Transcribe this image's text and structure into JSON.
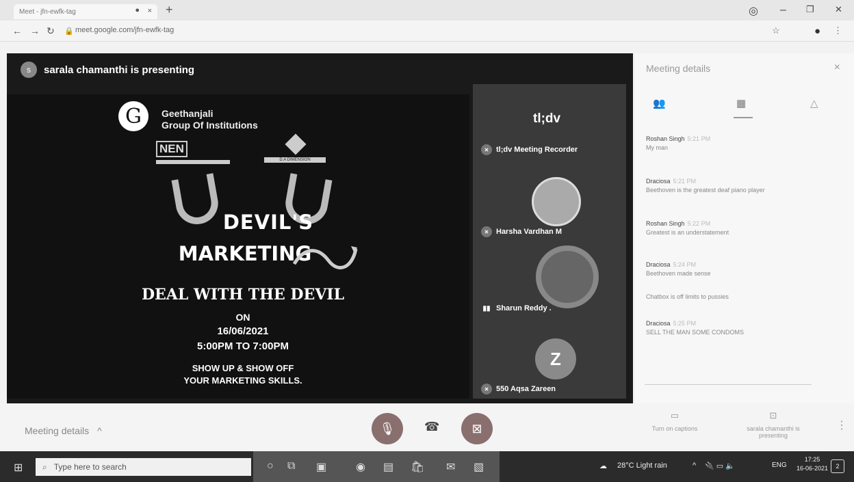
{
  "browser": {
    "tab_title": "Meet - jfn-ewfk-tag",
    "tab_close": "×",
    "tab_dot": "●",
    "new_tab": "+",
    "url": "meet.google.com/jfn-ewfk-tag",
    "win_minimize": "–",
    "win_restore": "❐",
    "win_close": "✕"
  },
  "presenter": {
    "initial": "s",
    "text": "sarala chamanthi is presenting"
  },
  "slide": {
    "logo_letter": "G",
    "institution_line1": "Geethanjali",
    "institution_line2": "Group Of Institutions",
    "nen_logo": "NEN",
    "dimension_logo": "D.A DIMENSION",
    "title_line1": "DEVIL'S",
    "title_line2": "MARKETING",
    "subtitle": "DEAL WITH THE DEVIL",
    "on": "ON",
    "date": "16/06/2021",
    "time": "5:00PM TO 7:00PM",
    "cta_line1": "SHOW UP & SHOW OFF",
    "cta_line2": "YOUR MARKETING SKILLS."
  },
  "participants": {
    "tldv_label": "tl;dv",
    "recorder": "tl;dv Meeting Recorder",
    "p1": "Harsha Vardhan M",
    "p2": "Sharun Reddy .",
    "p3": "550 Aqsa Zareen",
    "p3_initial": "Z"
  },
  "panel": {
    "title": "Meeting details",
    "close": "×",
    "messages": [
      {
        "sender": "Roshan Singh",
        "time": "5:21 PM",
        "text": "My man"
      },
      {
        "sender": "Draciosa",
        "time": "5:21 PM",
        "text": "Beethoven is the greatest deaf piano player"
      },
      {
        "sender": "Roshan Singh",
        "time": "5:22 PM",
        "text": "Greatest is an understatement"
      },
      {
        "sender": "Draciosa",
        "time": "5:24 PM",
        "text": "Beethoven made sense"
      },
      {
        "sender": "",
        "time": "",
        "text": "Chatbox is off limits to pussies"
      },
      {
        "sender": "Draciosa",
        "time": "5:25 PM",
        "text": "SELL THE MAN SOME CONDOMS"
      }
    ]
  },
  "bottom": {
    "meeting_details": "Meeting details",
    "caret": "^",
    "captions_label": "Turn on captions",
    "present_label": "sarala chamanthi is presenting",
    "more": "⋮"
  },
  "taskbar": {
    "search_placeholder": "Type here to search",
    "weather": "28°C  Light rain",
    "lang": "ENG",
    "time": "17:25",
    "date": "16-06-2021",
    "notif_count": "2"
  }
}
